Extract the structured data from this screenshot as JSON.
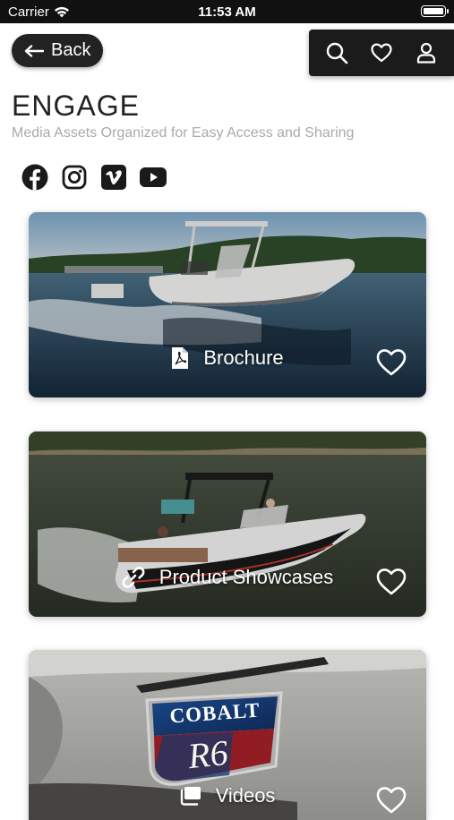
{
  "status_bar": {
    "carrier": "Carrier",
    "time": "11:53 AM"
  },
  "nav": {
    "back_label": "Back"
  },
  "header": {
    "title": "ENGAGE",
    "subtitle": "Media Assets Organized for Easy Access and Sharing"
  },
  "actions": [
    "search-icon",
    "heart-icon",
    "user-icon"
  ],
  "social": [
    "facebook-icon",
    "instagram-icon",
    "vimeo-icon",
    "youtube-icon"
  ],
  "cards": [
    {
      "label": "Brochure",
      "icon": "pdf-icon"
    },
    {
      "label": "Product Showcases",
      "icon": "link-icon"
    },
    {
      "label": "Videos",
      "icon": "video-library-icon",
      "badge": "COBALT",
      "model": "R6"
    }
  ],
  "colors": {
    "dark": "#1b1b1b",
    "subtitle": "#aaaaaa",
    "water": "#1f3a4d"
  }
}
